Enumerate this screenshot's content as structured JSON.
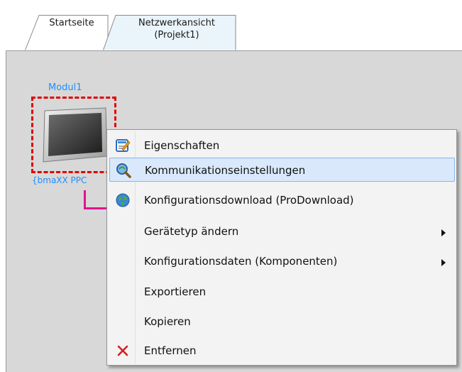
{
  "tabs": [
    {
      "label": "Startseite"
    },
    {
      "label": "Netzwerkansicht\n(Projekt1)"
    }
  ],
  "network": {
    "module_name": "Modul1",
    "device_type": "{bmaXX PPC"
  },
  "context_menu": {
    "items": [
      {
        "label": "Eigenschaften",
        "icon": "properties-icon",
        "highlighted": false,
        "submenu": false
      },
      {
        "label": "Kommunikationseinstellungen",
        "icon": "communication-search-icon",
        "highlighted": true,
        "submenu": false
      },
      {
        "label": "Konfigurationsdownload (ProDownload)",
        "icon": "globe-download-icon",
        "highlighted": false,
        "submenu": false
      },
      {
        "label": "Gerätetyp ändern",
        "icon": "",
        "highlighted": false,
        "submenu": true
      },
      {
        "label": "Konfigurationsdaten (Komponenten)",
        "icon": "",
        "highlighted": false,
        "submenu": true
      },
      {
        "label": "Exportieren",
        "icon": "",
        "highlighted": false,
        "submenu": false
      },
      {
        "label": "Kopieren",
        "icon": "",
        "highlighted": false,
        "submenu": false
      },
      {
        "label": "Entfernen",
        "icon": "delete-x-icon",
        "highlighted": false,
        "submenu": false
      }
    ]
  },
  "colors": {
    "workspace": "#d8d8d8",
    "selection": "#e00000",
    "module_label": "#1e8fff",
    "connection": "#e0148c",
    "highlight": "#d9e9fb"
  }
}
